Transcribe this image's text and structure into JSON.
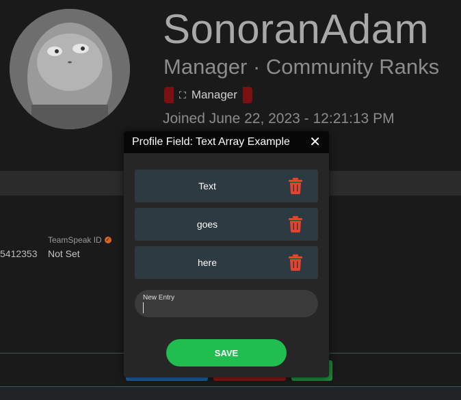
{
  "profile": {
    "username": "SonoranAdam",
    "subtitle": "Manager · Community Ranks",
    "rank_badge": {
      "label": "Manager",
      "icon": "arrows-icon"
    },
    "joined": "Joined June 22, 2023 - 12:21:13 PM"
  },
  "fields": {
    "left_value": "5412353",
    "teamspeak_label": "TeamSpeak ID",
    "teamspeak_value": "Not Set"
  },
  "modal": {
    "title": "Profile Field: Text Array Example",
    "close_glyph": "✕",
    "entries": [
      {
        "text": "Text"
      },
      {
        "text": "goes"
      },
      {
        "text": "here"
      }
    ],
    "new_entry_label": "New Entry",
    "new_entry_value": "",
    "save_label": "SAVE"
  },
  "colors": {
    "accent_green": "#20bd4f",
    "trash_red": "#e8412c",
    "badge_red": "#7a1010",
    "verified_orange": "#d4642a"
  }
}
